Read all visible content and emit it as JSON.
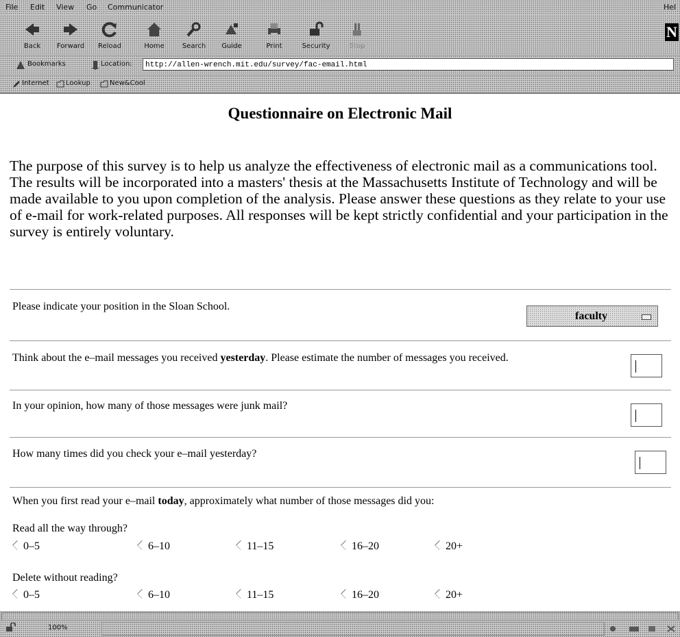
{
  "menu": [
    "File",
    "Edit",
    "View",
    "Go",
    "Communicator",
    "Hel"
  ],
  "toolbar": {
    "back": "Back",
    "forward": "Forward",
    "reload": "Reload",
    "home": "Home",
    "search": "Search",
    "guide": "Guide",
    "print": "Print",
    "security": "Security",
    "stop": "Stop"
  },
  "location": {
    "bookmarks": "Bookmarks",
    "label": "Location:",
    "url": "http://allen-wrench.mit.edu/survey/fac-email.html"
  },
  "personal_toolbar": [
    "Internet",
    "Lookup",
    "New&Cool"
  ],
  "page": {
    "title": "Questionnaire on Electronic Mail",
    "intro": "The purpose of this survey is to help us analyze the effectiveness of electronic mail as a communications tool. The results will be incorporated into a masters' thesis at the Massachusetts Institute of Technology and will be made available to you upon completion of the analysis. Please answer these questions as they relate to your use of e-mail for work-related purposes. All responses will be kept strictly confidential and your participation in the survey is entirely voluntary.",
    "q_position": "Please indicate your position in the Sloan School.",
    "position_selected": "faculty",
    "q_received_a": "Think about the e–mail messages you received ",
    "q_received_bold": "yesterday",
    "q_received_b": ". Please estimate the number of messages you received.",
    "q_junk": "In your opinion, how many of those messages were junk mail?",
    "q_checks": "How many times did you check your e–mail yesterday?",
    "q_today_a": "When you first read your e–mail ",
    "q_today_bold": "today",
    "q_today_b": ", approximately what number of those messages did you:",
    "read_through": "Read all the way through?",
    "delete_without": "Delete without reading?",
    "options": [
      "0–5",
      "6–10",
      "11–15",
      "16–20",
      "20+"
    ]
  },
  "status": {
    "zoom": "100%"
  }
}
